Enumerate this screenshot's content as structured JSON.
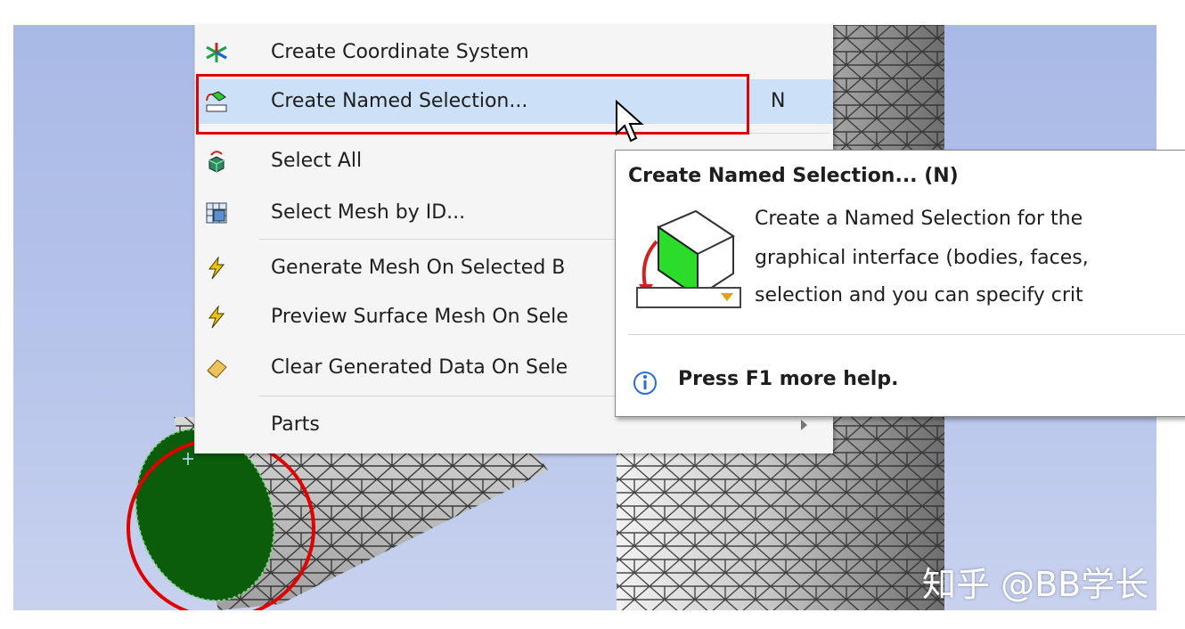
{
  "context_menu": {
    "items": [
      {
        "label": "Create Coordinate System",
        "icon": "coordinate-system-icon",
        "shortcut": ""
      },
      {
        "label": "Create Named Selection...",
        "icon": "named-selection-icon",
        "shortcut": "N"
      },
      {
        "label": "Select All",
        "icon": "select-all-icon",
        "shortcut": ""
      },
      {
        "label": "Select Mesh by ID...",
        "icon": "mesh-id-icon",
        "shortcut": ""
      },
      {
        "label": "Generate Mesh On Selected B",
        "icon": "lightning-icon",
        "shortcut": ""
      },
      {
        "label": "Preview Surface Mesh On Sele",
        "icon": "lightning-icon",
        "shortcut": ""
      },
      {
        "label": "Clear Generated Data On Sele",
        "icon": "eraser-icon",
        "shortcut": ""
      },
      {
        "label": "Parts",
        "icon": "",
        "shortcut": ""
      }
    ],
    "highlighted_index": 1,
    "highlight_color": "#cce0f7"
  },
  "tooltip": {
    "title": "Create Named Selection... (N)",
    "lines": [
      "Create a Named Selection for the",
      "graphical interface (bodies, faces,",
      "selection and you can specify crit"
    ],
    "help": "Press F1 more help."
  },
  "annotations": {
    "color": "#e00000"
  },
  "watermark": "知乎 @BB学长",
  "colors": {
    "selected_face": "#0b5c0b",
    "viewport_top": "#a9b9e6",
    "viewport_bottom": "#c8d2ef"
  }
}
